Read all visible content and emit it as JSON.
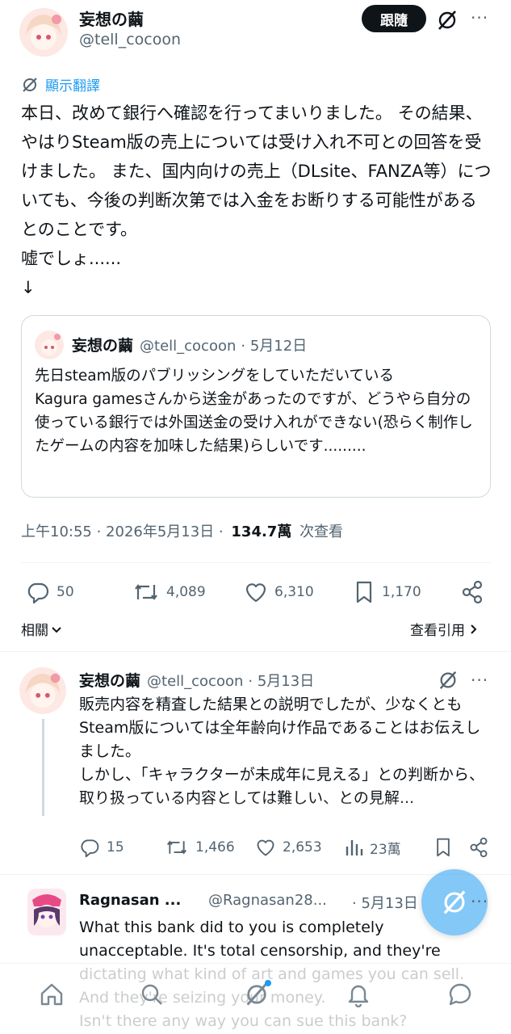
{
  "main_tweet": {
    "author_name": "妄想の繭",
    "author_handle": "@tell_cocoon",
    "follow_label": "跟隨",
    "translate_label": "顯示翻譯",
    "text": "本日、改めて銀行へ確認を行ってまいりました。 その結果、やはりSteam版の売上については受け入れ不可との回答を受けました。 また、国内向けの売上（DLsite、FANZA等）についても、今後の判断次第では入金をお断りする可能性があるとのことです。\n嘘でしょ......\n↓",
    "quote": {
      "author_name": "妄想の繭",
      "author_handle": "@tell_cocoon",
      "date": "· 5月12日",
      "text": "先日steam版のパブリッシングをしていただいている\nKagura gamesさんから送金があったのですが、どうやら自分の使っている銀行では外国送金の受け入れができない(恐らく制作したゲームの内容を加味した結果)らしいです........."
    },
    "meta": {
      "time": "上午10:55 · 2026年5月13日 ·",
      "views_count": "134.7萬",
      "views_label": "次查看"
    },
    "actions": {
      "replies": "50",
      "retweets": "4,089",
      "likes": "6,310",
      "bookmarks": "1,170"
    },
    "related_label": "相關",
    "quotes_label": "查看引用"
  },
  "reply_1": {
    "author_name": "妄想の繭",
    "author_handle": "@tell_cocoon",
    "date": "· 5月13日",
    "text": "販売内容を精査した結果との説明でしたが、少なくともSteam版については全年齢向け作品であることはお伝えしました。\nしかし、「キャラクターが未成年に見える」との判断から、取り扱っている内容としては難しい、との見解...",
    "actions": {
      "replies": "15",
      "retweets": "1,466",
      "likes": "2,653",
      "views": "23萬"
    }
  },
  "reply_2": {
    "author_name": "Ragnasan ...",
    "author_handle": "@Ragnasan28...",
    "date": "· 5月13日",
    "text": "What this bank did to you is completely unacceptable. It's total censorship, and they're dictating what kind of art and games you can sell. And they're seizing your money.\nIsn't there any way you can sue this bank?"
  },
  "colors": {
    "accent": "#1d9bf0",
    "text": "#0f1419",
    "secondary": "#536471",
    "border": "#cfd9de"
  },
  "icons": {
    "nav": [
      "home-icon",
      "search-icon",
      "grok-icon",
      "notifications-icon",
      "messages-icon"
    ]
  }
}
